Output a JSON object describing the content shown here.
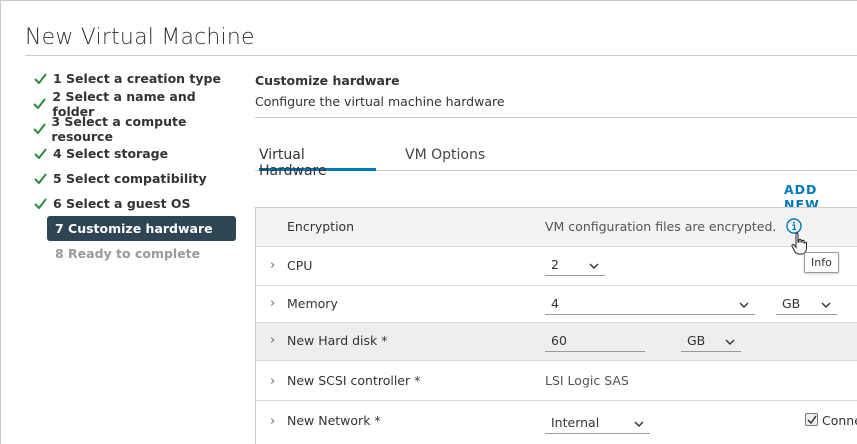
{
  "dialog": {
    "title": "New Virtual Machine"
  },
  "steps": [
    {
      "label": "1 Select a creation type",
      "state": "done"
    },
    {
      "label": "2 Select a name and folder",
      "state": "done"
    },
    {
      "label": "3 Select a compute resource",
      "state": "done"
    },
    {
      "label": "4 Select storage",
      "state": "done"
    },
    {
      "label": "5 Select compatibility",
      "state": "done"
    },
    {
      "label": "6 Select a guest OS",
      "state": "done"
    },
    {
      "label": "7 Customize hardware",
      "state": "active"
    },
    {
      "label": "8 Ready to complete",
      "state": "future"
    }
  ],
  "main": {
    "title": "Customize hardware",
    "subtitle": "Configure the virtual machine hardware",
    "tabs": [
      {
        "label": "Virtual Hardware",
        "active": true
      },
      {
        "label": "VM Options",
        "active": false
      }
    ],
    "add_new_label": "ADD NEW"
  },
  "hardware": {
    "encryption": {
      "label": "Encryption",
      "value": "VM configuration files are encrypted.",
      "tooltip": "Info"
    },
    "cpu": {
      "label": "CPU",
      "value": "2"
    },
    "memory": {
      "label": "Memory",
      "value": "4",
      "unit": "GB"
    },
    "hard_disk": {
      "label": "New Hard disk *",
      "value": "60",
      "unit": "GB"
    },
    "scsi": {
      "label": "New SCSI controller *",
      "value": "LSI Logic SAS"
    },
    "network": {
      "label": "New Network *",
      "value": "Internal",
      "connect_label": "Conne",
      "connected": true
    }
  },
  "colors": {
    "accent": "#0079b8",
    "active_step_bg": "#2d4554",
    "check_green": "#2e8b3e"
  }
}
